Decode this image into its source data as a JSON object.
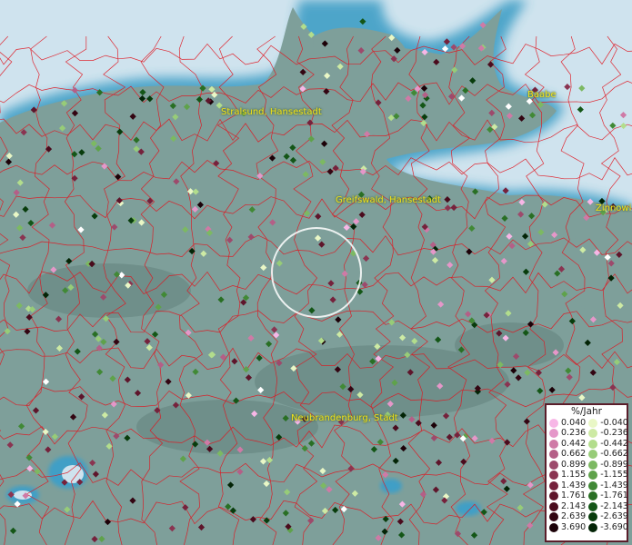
{
  "map": {
    "places": [
      {
        "id": "stralsund",
        "name": "Stralsund, Hansestadt"
      },
      {
        "id": "greifswald",
        "name": "Greifswald, Hansestadt"
      },
      {
        "id": "neubrandenburg",
        "name": "Neubrandenburg, Stadt"
      },
      {
        "id": "baabe",
        "name": "Baabe"
      },
      {
        "id": "zinnowitz",
        "name": "Zinnowi"
      }
    ],
    "colors": {
      "water": "#cfe3ee",
      "coast_glow": "#3f9fc6",
      "land": "#7e9f9a",
      "borders": "#e0141e",
      "circle": "#ffffff"
    }
  },
  "legend": {
    "unit": "%/Jahr",
    "positive": [
      {
        "value": "0.040",
        "color": "#f7b6e6"
      },
      {
        "value": "0.236",
        "color": "#e597c9"
      },
      {
        "value": "0.442",
        "color": "#cf7aa6"
      },
      {
        "value": "0.662",
        "color": "#b45f87"
      },
      {
        "value": "0.899",
        "color": "#9d4a6c"
      },
      {
        "value": "1.155",
        "color": "#8a3451"
      },
      {
        "value": "1.439",
        "color": "#75223c"
      },
      {
        "value": "1.761",
        "color": "#5e152b"
      },
      {
        "value": "2.143",
        "color": "#4a0b1d"
      },
      {
        "value": "2.639",
        "color": "#330512"
      },
      {
        "value": "3.690",
        "color": "#1c0108"
      }
    ],
    "negative": [
      {
        "value": "-0.040",
        "color": "#e9f7c6"
      },
      {
        "value": "-0.236",
        "color": "#cdeaa4"
      },
      {
        "value": "-0.442",
        "color": "#b2dd8c"
      },
      {
        "value": "-0.662",
        "color": "#97cc78"
      },
      {
        "value": "-0.899",
        "color": "#7cb962"
      },
      {
        "value": "-1.155",
        "color": "#5fa24b"
      },
      {
        "value": "-1.439",
        "color": "#418936"
      },
      {
        "value": "-1.761",
        "color": "#296f24"
      },
      {
        "value": "-2.143",
        "color": "#145617"
      },
      {
        "value": "-2.639",
        "color": "#083c0c"
      },
      {
        "value": "-3.690",
        "color": "#032406"
      }
    ]
  }
}
